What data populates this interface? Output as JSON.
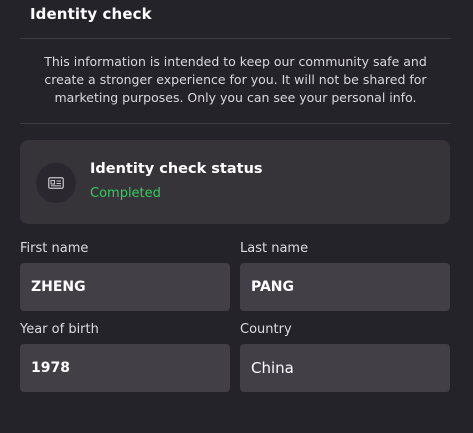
{
  "header": {
    "title": "Identity check"
  },
  "info": {
    "text": "This information is intended to keep our community safe and create a stronger experience for you. It will not be shared for marketing purposes. Only you can see your personal info."
  },
  "status_card": {
    "icon": "id-card-icon",
    "title": "Identity check status",
    "value": "Completed",
    "value_color": "#2fd05a"
  },
  "form": {
    "first_name": {
      "label": "First name",
      "value": "ZHENG"
    },
    "last_name": {
      "label": "Last name",
      "value": "PANG"
    },
    "year_of_birth": {
      "label": "Year of birth",
      "value": "1978"
    },
    "country": {
      "label": "Country",
      "value": "China"
    }
  }
}
